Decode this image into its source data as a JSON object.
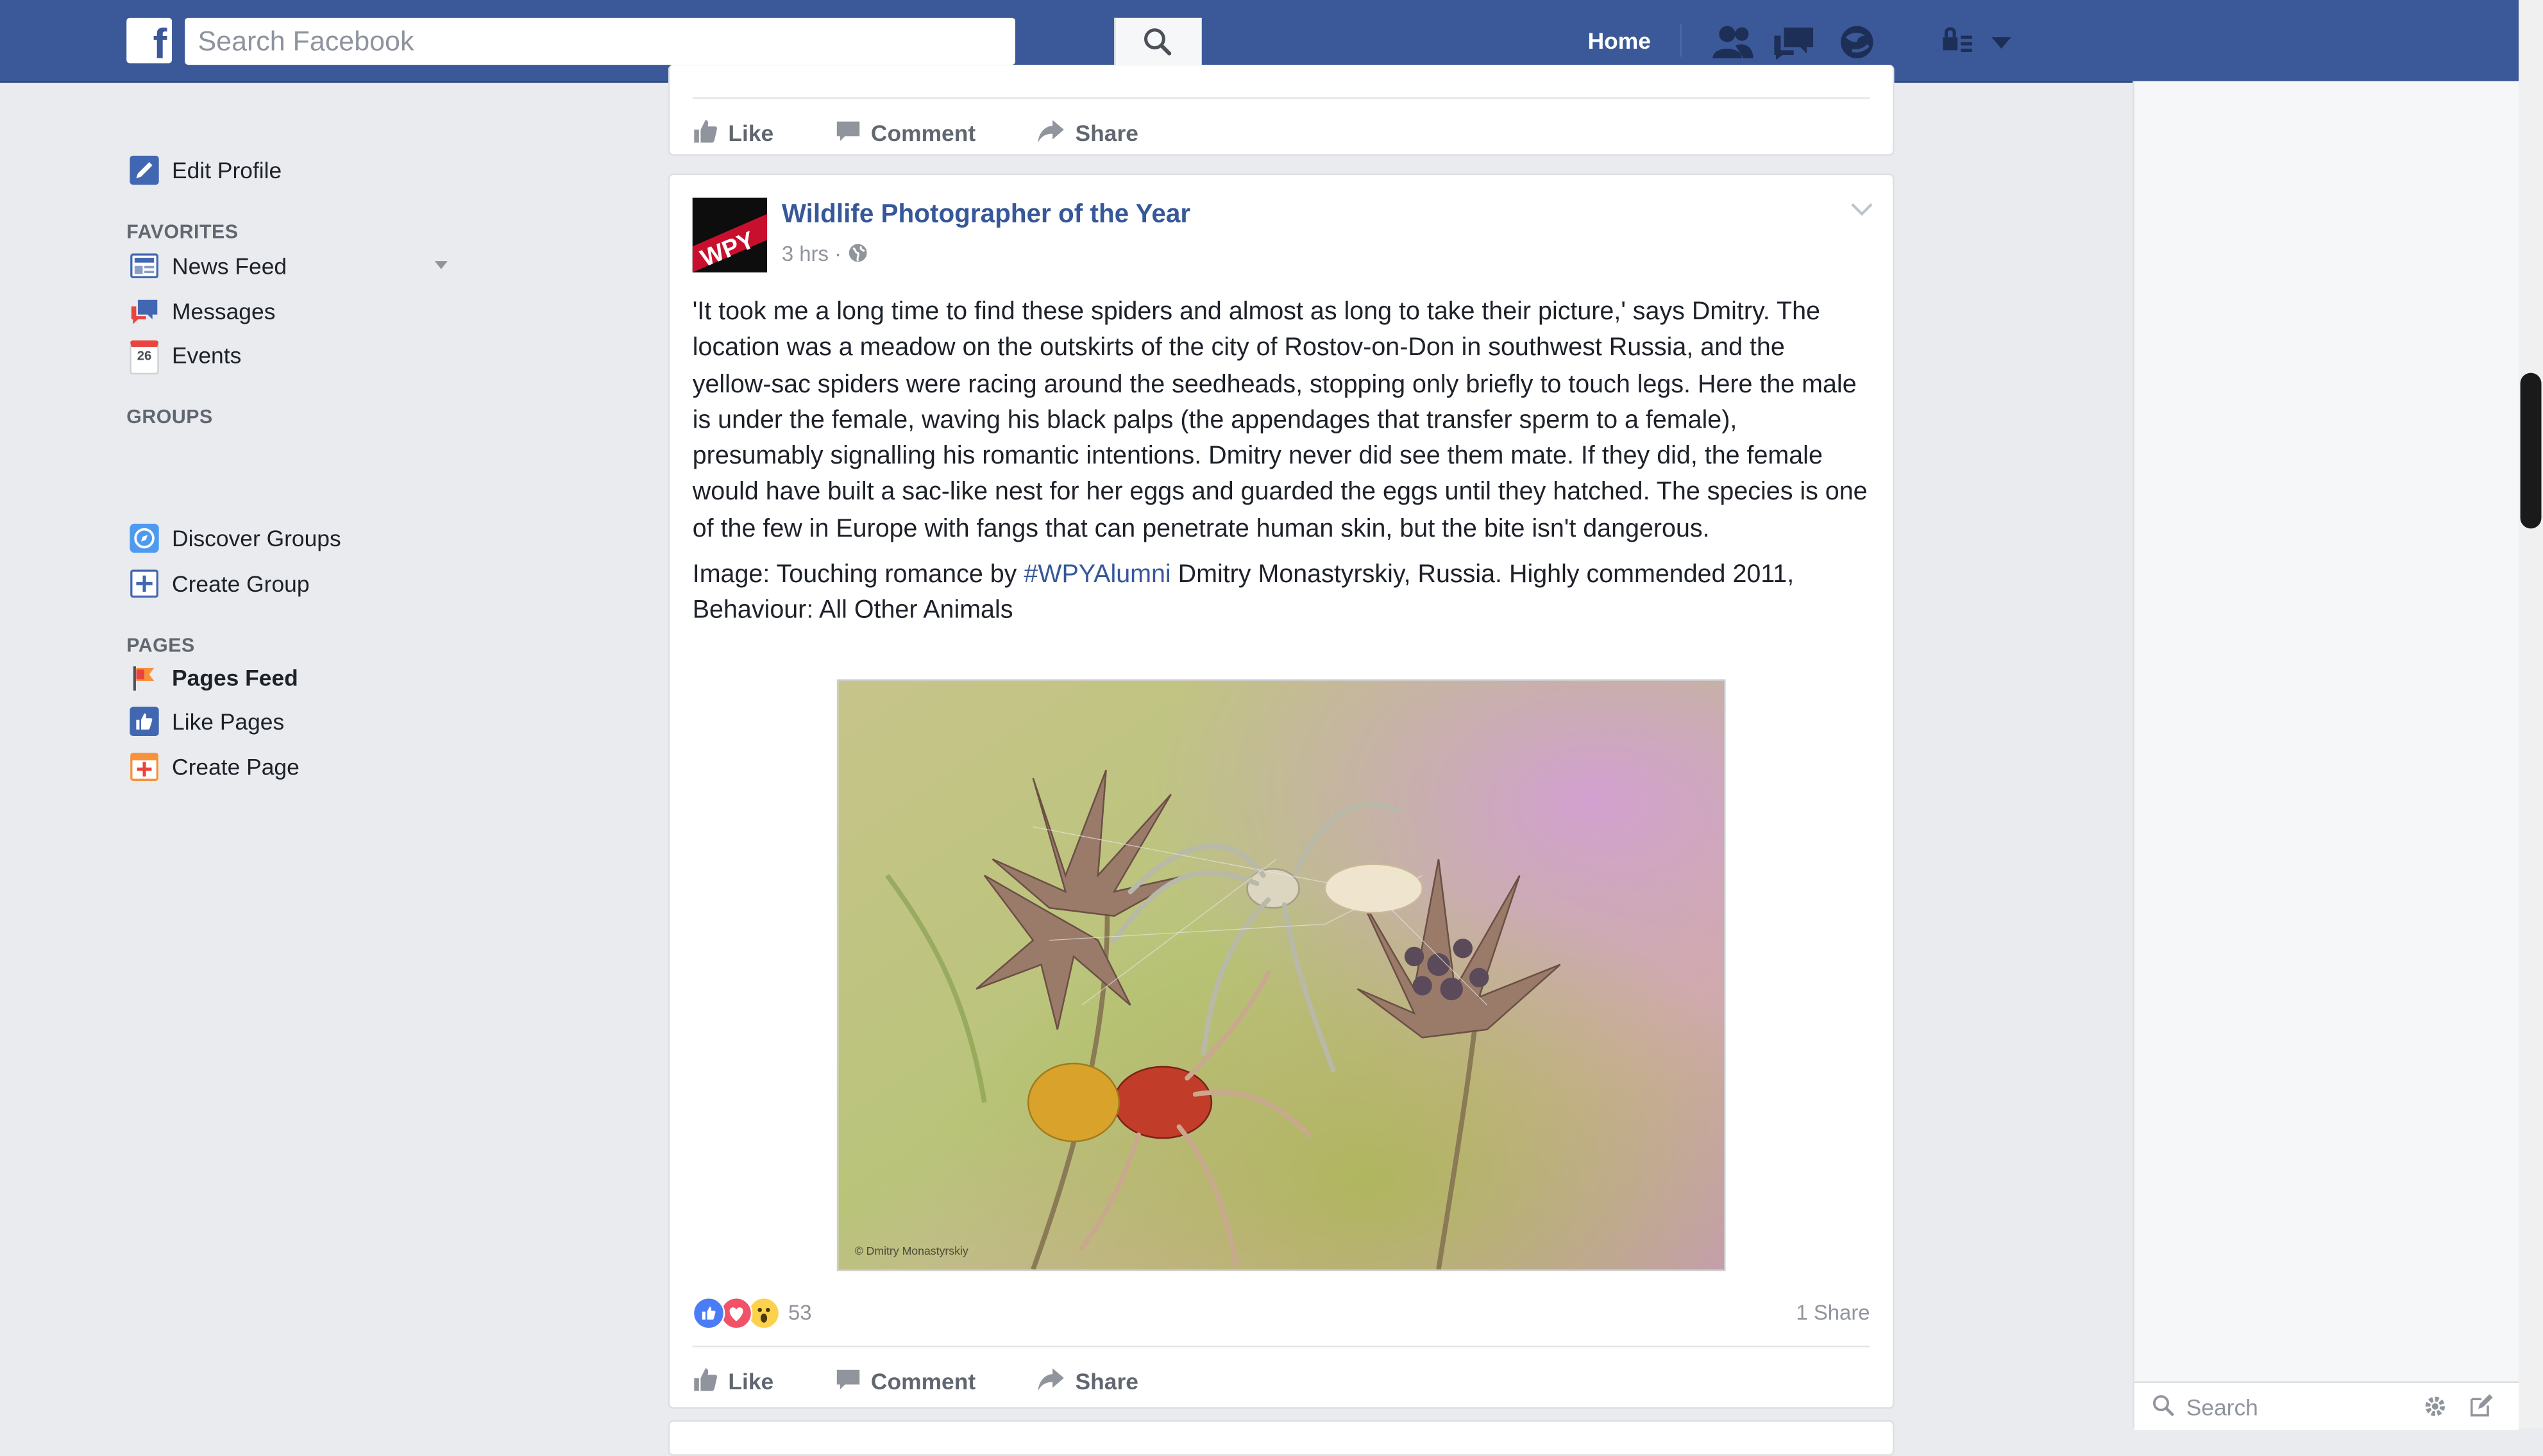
{
  "topbar": {
    "search_placeholder": "Search Facebook",
    "home_label": "Home",
    "icons": [
      "facebook-logo",
      "search-icon",
      "friend-requests-icon",
      "messages-icon",
      "notifications-icon",
      "privacy-shortcuts-icon",
      "account-menu-icon"
    ],
    "brand_color": "#3b5998"
  },
  "leftnav": {
    "edit_profile": "Edit Profile",
    "favorites_header": "FAVORITES",
    "favorites": [
      "News Feed",
      "Messages",
      "Events"
    ],
    "events_day": "26",
    "groups_header": "GROUPS",
    "groups": [
      "Discover Groups",
      "Create Group"
    ],
    "pages_header": "PAGES",
    "pages": [
      "Pages Feed",
      "Like Pages",
      "Create Page"
    ]
  },
  "actions": {
    "like": "Like",
    "comment": "Comment",
    "share": "Share"
  },
  "post": {
    "page_name": "Wildlife Photographer of the Year",
    "avatar_text": "WPY",
    "time": "3 hrs",
    "meta_sep": "·",
    "body": "'It took me a long time to find these spiders and almost as long to take their picture,' says Dmitry. The location was a meadow on the outskirts of the city of Rostov-on-Don in southwest Russia, and the yellow-sac spiders were racing around the seedheads, stopping only briefly to touch legs. Here the male is under the female, waving his black palps (the appendages that transfer sperm to a female), presumably signalling his romantic intentions. Dmitry never did see them mate. If they did, the female would have built a sac-like nest for her eggs and guarded the eggs until they hatched. The species is one of the few in Europe with fangs that can penetrate human skin, but the bite isn't dangerous.",
    "caption_before": "Image: Touching romance by ",
    "hashtag": "#WPYAlumni",
    "caption_after": " Dmitry Monastyrskiy, Russia. Highly commended 2011, Behaviour: All Other Animals",
    "photo_credit": "© Dmitry Monastyrskiy",
    "reaction_count": "53",
    "reactions": [
      "like",
      "love",
      "wow"
    ],
    "share_count": "1 Share"
  },
  "chat": {
    "search_placeholder": "Search"
  }
}
